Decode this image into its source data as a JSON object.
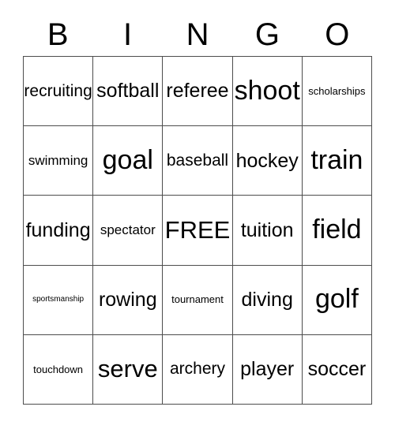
{
  "card": {
    "title": "BINGO",
    "headers": [
      "B",
      "I",
      "N",
      "G",
      "O"
    ],
    "free_space_label": "FREE",
    "colors": {
      "background": "#ffffff",
      "text": "#000000",
      "grid_line": "#4d4d4d"
    },
    "rows": [
      [
        {
          "label": "recruiting",
          "size": "s4"
        },
        {
          "label": "softball",
          "size": "s3"
        },
        {
          "label": "referee",
          "size": "s3"
        },
        {
          "label": "shoot",
          "size": "s1"
        },
        {
          "label": "scholarships",
          "size": "s6"
        }
      ],
      [
        {
          "label": "swimming",
          "size": "s5"
        },
        {
          "label": "goal",
          "size": "s1"
        },
        {
          "label": "baseball",
          "size": "s4"
        },
        {
          "label": "hockey",
          "size": "s3"
        },
        {
          "label": "train",
          "size": "s1"
        }
      ],
      [
        {
          "label": "funding",
          "size": "s3"
        },
        {
          "label": "spectator",
          "size": "s5"
        },
        {
          "label": "FREE",
          "size": "s2"
        },
        {
          "label": "tuition",
          "size": "s3"
        },
        {
          "label": "field",
          "size": "s1"
        }
      ],
      [
        {
          "label": "sportsmanship",
          "size": "s7"
        },
        {
          "label": "rowing",
          "size": "s3"
        },
        {
          "label": "tournament",
          "size": "s6"
        },
        {
          "label": "diving",
          "size": "s3"
        },
        {
          "label": "golf",
          "size": "s1"
        }
      ],
      [
        {
          "label": "touchdown",
          "size": "s6"
        },
        {
          "label": "serve",
          "size": "s2"
        },
        {
          "label": "archery",
          "size": "s4"
        },
        {
          "label": "player",
          "size": "s3"
        },
        {
          "label": "soccer",
          "size": "s3"
        }
      ]
    ]
  }
}
